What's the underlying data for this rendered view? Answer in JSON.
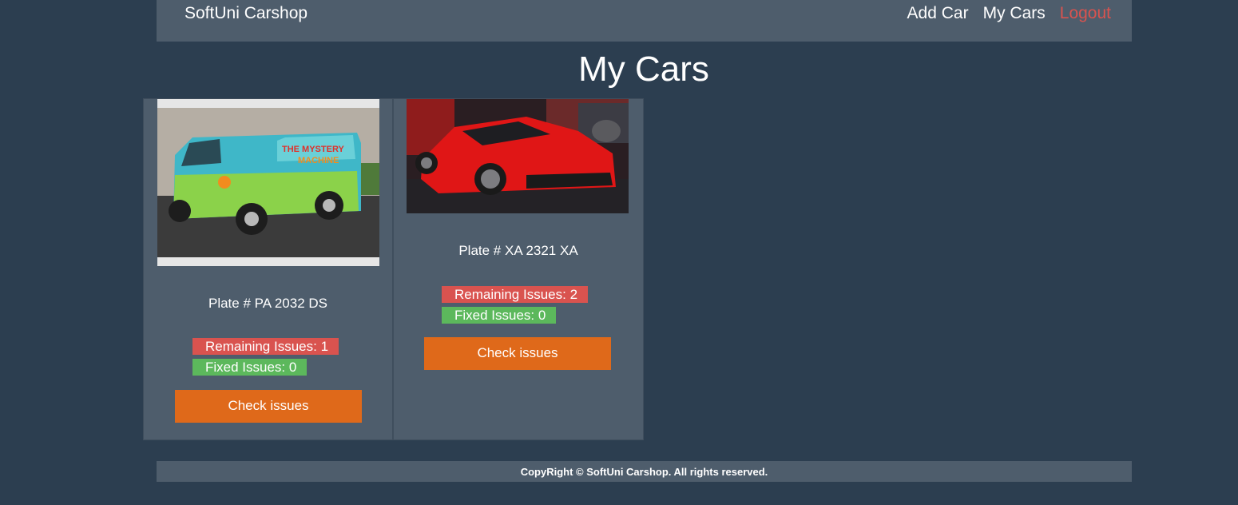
{
  "nav": {
    "brand": "SoftUni Carshop",
    "links": [
      {
        "label": "Add Car"
      },
      {
        "label": "My Cars"
      },
      {
        "label": "Logout"
      }
    ]
  },
  "page": {
    "title": "My Cars"
  },
  "cars": [
    {
      "plate": "Plate # PA 2032 DS",
      "image_icon": "van-photo",
      "remaining": "Remaining Issues: 1",
      "fixed": "Fixed Issues: 0",
      "button": "Check issues"
    },
    {
      "plate": "Plate # XA 2321 XA",
      "image_icon": "red-sportscar-photo",
      "remaining": "Remaining Issues: 2",
      "fixed": "Fixed Issues: 0",
      "button": "Check issues"
    }
  ],
  "footer": {
    "text": "CopyRight © SoftUni Carshop. All rights reserved."
  },
  "colors": {
    "background": "#2c3e50",
    "panel": "#4e5d6c",
    "accent": "#df691a",
    "danger": "#d9534f",
    "success": "#5cb85c"
  }
}
